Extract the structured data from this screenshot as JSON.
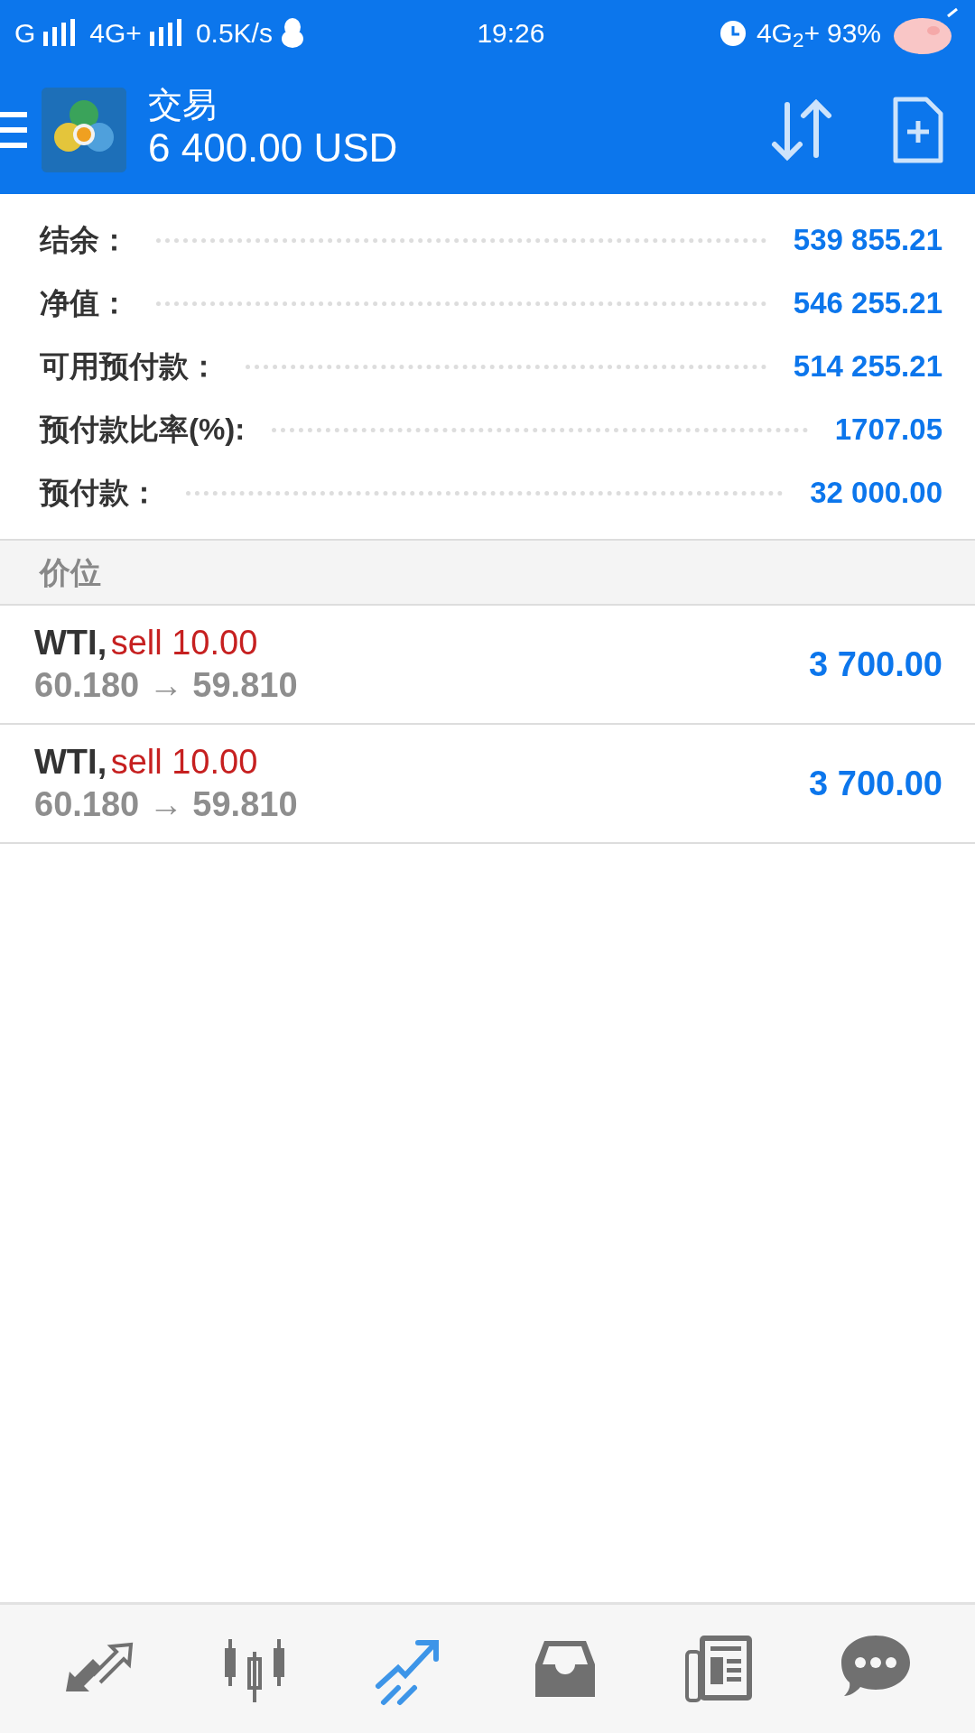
{
  "status_bar": {
    "carrier_1": "G",
    "carrier_2": "4G+",
    "speed": "0.5K/s",
    "time": "19:26",
    "network": "4G$_{2}$+",
    "battery": "93%"
  },
  "header": {
    "title": "交易",
    "balance": "6 400.00 USD"
  },
  "summary": [
    {
      "label": "结余：",
      "value": "539 855.21"
    },
    {
      "label": "净值：",
      "value": "546 255.21"
    },
    {
      "label": "可用预付款：",
      "value": "514 255.21"
    },
    {
      "label": "预付款比率(%):",
      "value": "1707.05"
    },
    {
      "label": "预付款：",
      "value": "32 000.00"
    }
  ],
  "section_title": "价位",
  "positions": [
    {
      "symbol": "WTI,",
      "order": "sell 10.00",
      "prices": "60.180 → 59.810",
      "profit": "3 700.00"
    },
    {
      "symbol": "WTI,",
      "order": "sell 10.00",
      "prices": "60.180 → 59.810",
      "profit": "3 700.00"
    }
  ],
  "bottom_nav": [
    {
      "kind": "quotes",
      "selected": false
    },
    {
      "kind": "chart",
      "selected": false
    },
    {
      "kind": "trade",
      "selected": true
    },
    {
      "kind": "inbox",
      "selected": false
    },
    {
      "kind": "news",
      "selected": false
    },
    {
      "kind": "chat",
      "selected": false
    }
  ]
}
